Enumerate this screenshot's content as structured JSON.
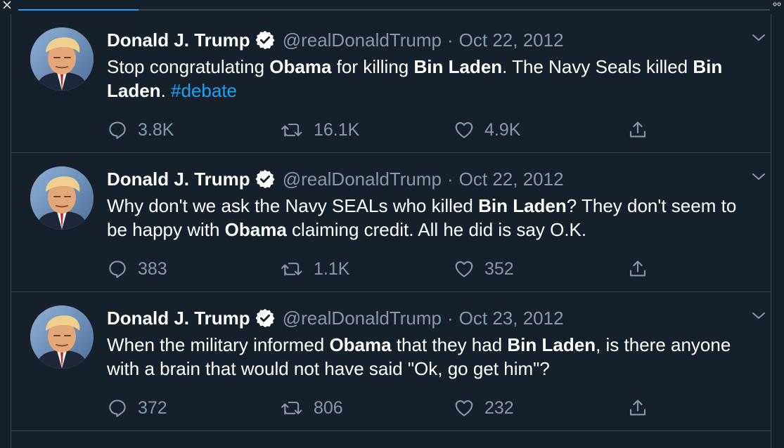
{
  "window": {
    "progress_fraction": 0.16
  },
  "colors": {
    "background": "#15202b",
    "border": "#38444d",
    "muted": "#8899a6",
    "accent": "#1da1f2",
    "text": "#ffffff"
  },
  "icons": [
    "close-icon",
    "more-dots-icon",
    "verified-badge-icon",
    "chevron-down-icon",
    "reply-icon",
    "retweet-icon",
    "like-icon",
    "share-icon"
  ],
  "tweets": [
    {
      "name": "Donald J. Trump",
      "handle": "@realDonaldTrump",
      "separator": "·",
      "date": "Oct 22, 2012",
      "text_parts": [
        {
          "t": "Stop congratulating ",
          "style": "plain"
        },
        {
          "t": "Obama",
          "style": "bold"
        },
        {
          "t": " for killing ",
          "style": "plain"
        },
        {
          "t": "Bin Laden",
          "style": "bold"
        },
        {
          "t": ". The Navy Seals killed ",
          "style": "plain"
        },
        {
          "t": "Bin Laden",
          "style": "bold"
        },
        {
          "t": ". ",
          "style": "plain"
        },
        {
          "t": "#debate",
          "style": "hashtag"
        }
      ],
      "replies": "3.8K",
      "retweets": "16.1K",
      "likes": "4.9K"
    },
    {
      "name": "Donald J. Trump",
      "handle": "@realDonaldTrump",
      "separator": "·",
      "date": "Oct 22, 2012",
      "text_parts": [
        {
          "t": "Why don't we ask the Navy SEALs who killed ",
          "style": "plain"
        },
        {
          "t": "Bin Laden",
          "style": "bold"
        },
        {
          "t": "? They don't seem to be happy with ",
          "style": "plain"
        },
        {
          "t": "Obama",
          "style": "bold"
        },
        {
          "t": " claiming credit. All he did is say O.K.",
          "style": "plain"
        }
      ],
      "replies": "383",
      "retweets": "1.1K",
      "likes": "352"
    },
    {
      "name": "Donald J. Trump",
      "handle": "@realDonaldTrump",
      "separator": "·",
      "date": "Oct 23, 2012",
      "text_parts": [
        {
          "t": "When the military informed ",
          "style": "plain"
        },
        {
          "t": "Obama",
          "style": "bold"
        },
        {
          "t": " that they had ",
          "style": "plain"
        },
        {
          "t": "Bin Laden",
          "style": "bold"
        },
        {
          "t": ", is there anyone with a brain that would not have said \"Ok, go get him\"?",
          "style": "plain"
        }
      ],
      "replies": "372",
      "retweets": "806",
      "likes": "232"
    }
  ]
}
